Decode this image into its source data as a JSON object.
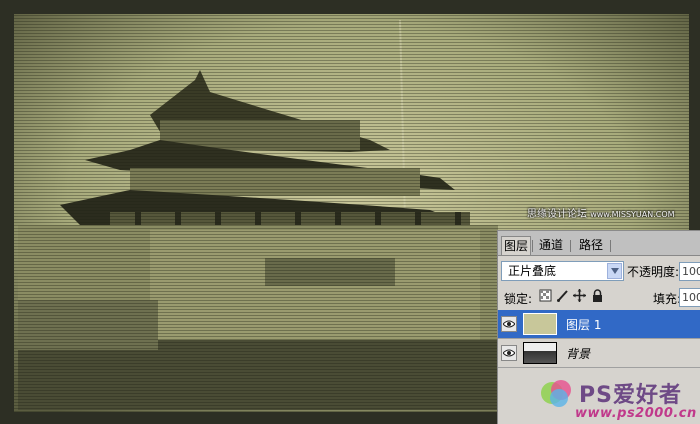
{
  "watermark_top": {
    "cn": "思缘设计论坛",
    "url": "www.MISSYUAN.COM"
  },
  "panel": {
    "tabs": [
      "图层",
      "通道",
      "路径"
    ],
    "blend_mode": "正片叠底",
    "opacity_label": "不透明度:",
    "opacity_value": "100",
    "lock_label": "锁定:",
    "fill_label": "填充:",
    "fill_value": "100",
    "layers": [
      {
        "name": "图层 1",
        "selected": true
      },
      {
        "name": "背景",
        "selected": false
      }
    ]
  },
  "brand": {
    "name": "PS爱好者",
    "url": "www.ps2000.cn"
  },
  "colors": {
    "selected_row": "#3169c6",
    "panel_bg": "#d6d3ce",
    "photo_tint": "#b3b78e"
  }
}
